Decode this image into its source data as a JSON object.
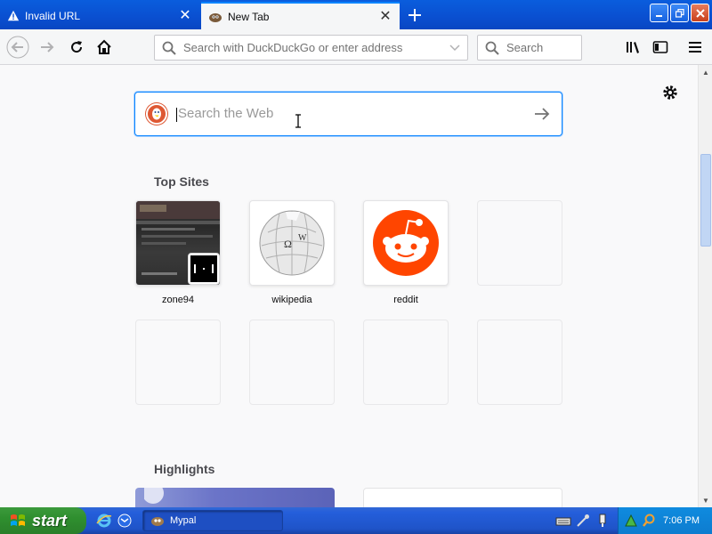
{
  "tabs": [
    {
      "label": "Invalid URL",
      "active": false
    },
    {
      "label": "New Tab",
      "active": true
    }
  ],
  "toolbar": {
    "url_placeholder": "Search with DuckDuckGo or enter address",
    "search_placeholder": "Search"
  },
  "content": {
    "web_search_placeholder": "Search the Web",
    "top_sites_title": "Top Sites",
    "top_sites": [
      {
        "label": "zone94"
      },
      {
        "label": "wikipedia"
      },
      {
        "label": "reddit"
      },
      {
        "label": ""
      }
    ],
    "highlights_title": "Highlights"
  },
  "taskbar": {
    "start_label": "start",
    "task_label": "Mypal",
    "clock": "7:06 PM"
  },
  "colors": {
    "accent": "#0a84ff",
    "reddit": "#ff4500",
    "duckduckgo": "#de5833",
    "xp_blue": "#245edb",
    "xp_green": "#2f8f2f"
  }
}
